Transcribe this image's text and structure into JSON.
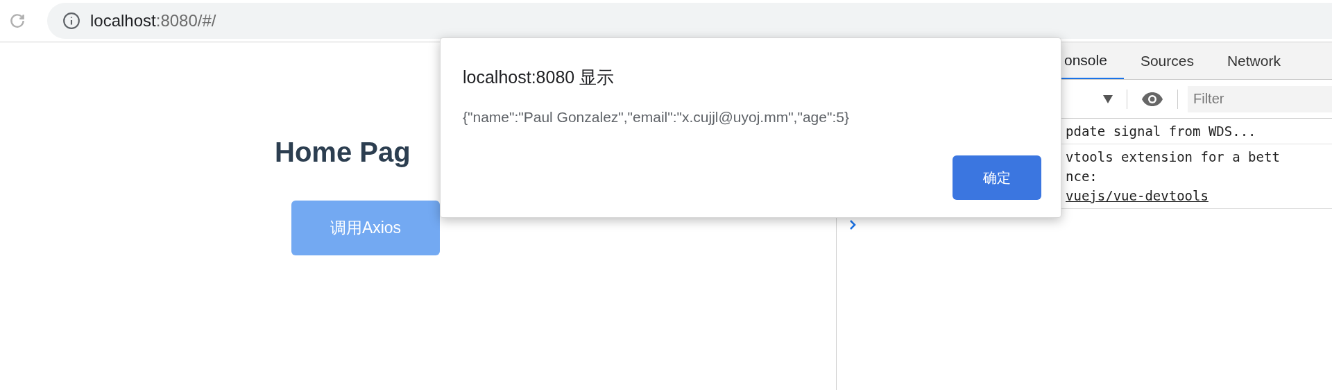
{
  "browser": {
    "url_host": "localhost",
    "url_rest": ":8080/#/"
  },
  "page": {
    "heading": "Home Pag",
    "button": "调用Axios"
  },
  "dialog": {
    "title": "localhost:8080 显示",
    "message": "{\"name\":\"Paul Gonzalez\",\"email\":\"x.cujjl@uyoj.mm\",\"age\":5}",
    "button": "确定"
  },
  "devtools": {
    "tabs": [
      {
        "label": "onsole",
        "selected": true
      },
      {
        "label": "Sources",
        "selected": false
      },
      {
        "label": "Network",
        "selected": false
      }
    ],
    "filter": {
      "placeholder": "Filter"
    },
    "messages": [
      {
        "lines": [
          "pdate signal from WDS..."
        ]
      },
      {
        "lines": [
          "vtools extension for a bett",
          "nce:"
        ],
        "link": "vuejs/vue-devtools"
      }
    ]
  }
}
